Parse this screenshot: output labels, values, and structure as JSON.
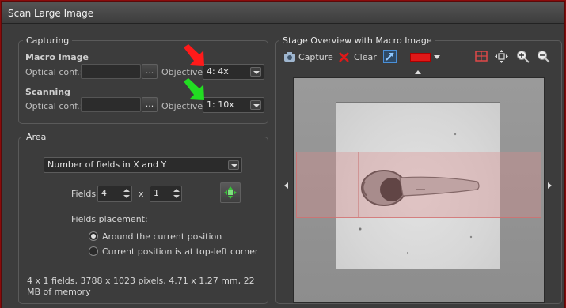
{
  "window": {
    "title": "Scan Large Image"
  },
  "capturing": {
    "title": "Capturing",
    "macro_heading": "Macro Image",
    "optical_conf_label": "Optical conf.:",
    "browse_label": "...",
    "objective_label": "Objective:",
    "macro_objective": "4: 4x",
    "scanning_heading": "Scanning",
    "scan_objective": "1: 10x"
  },
  "area": {
    "title": "Area",
    "mode": "Number of fields in X and Y",
    "fields_label": "Fields:",
    "fields_x": "4",
    "times": "x",
    "fields_y": "1",
    "placement_label": "Fields placement:",
    "option_around": "Around the current position",
    "option_topleft": "Current position is at top-left corner",
    "summary": "4 x 1 fields, 3788 x 1023 pixels, 4.71 x 1.27 mm, 22 MB of memory"
  },
  "stage": {
    "title": "Stage Overview with Macro Image",
    "capture_label": "Capture",
    "clear_label": "Clear"
  },
  "colors": {
    "accent_red": "#e01818",
    "arrow_red": "#ff1a1a",
    "arrow_green": "#22dd22",
    "scan_rect": "#d88a8a"
  },
  "icons": [
    "camera-icon",
    "clear-x-icon",
    "expand-arrow-icon",
    "color-swatch-icon",
    "grid-icon",
    "fit-icon",
    "zoom-in-icon",
    "zoom-out-icon",
    "green-arrows-icon"
  ]
}
